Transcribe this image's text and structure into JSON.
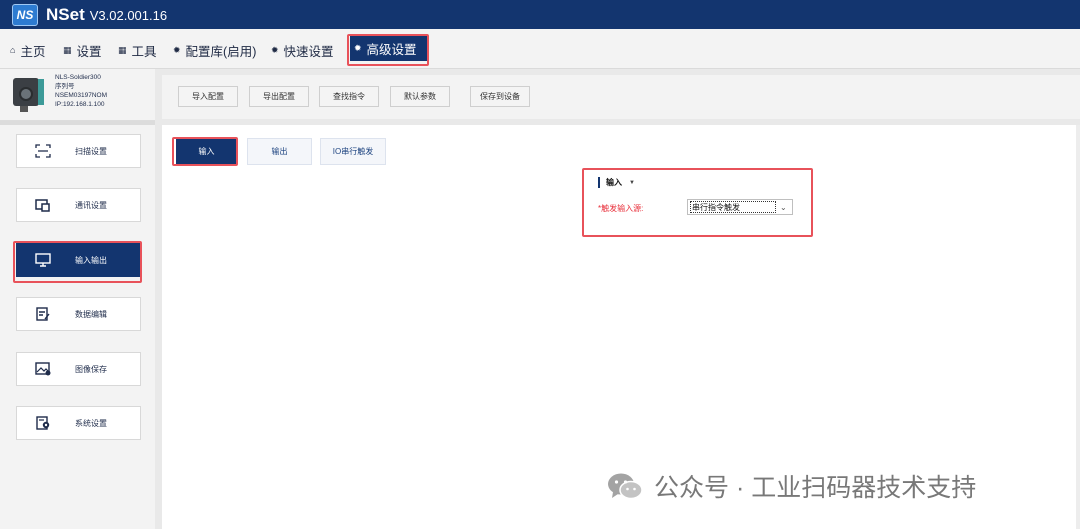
{
  "app": {
    "logo_text": "NS",
    "name": "NSet",
    "version": "V3.02.001.16",
    "accent": "#13356f",
    "highlight": "#e8525a"
  },
  "menu": {
    "home": "主页",
    "settings": "设置",
    "tools": "工具",
    "config_lib": "配置库(启用)",
    "quick_settings": "快速设置",
    "advanced_settings": "高级设置"
  },
  "device": {
    "model": "NLS-Soldier300",
    "serial_label": "序列号",
    "serial": "NSEM03197NOM",
    "ip": "IP:192.168.1.100"
  },
  "sidebar": {
    "items": [
      {
        "label": "扫描设置",
        "icon": "scan-icon"
      },
      {
        "label": "通讯设置",
        "icon": "communication-icon"
      },
      {
        "label": "输入输出",
        "icon": "monitor-icon"
      },
      {
        "label": "数据编辑",
        "icon": "edit-document-icon"
      },
      {
        "label": "图像保存",
        "icon": "image-save-icon"
      },
      {
        "label": "系统设置",
        "icon": "system-settings-icon"
      }
    ]
  },
  "toolbar": {
    "import_config": "导入配置",
    "export_config": "导出配置",
    "find_command": "查找指令",
    "default_params": "默认参数",
    "save_to_device": "保存到设备"
  },
  "tabs": {
    "input": "输入",
    "output": "输出",
    "io_serial": "IO串行触发"
  },
  "input_section": {
    "title": "输入",
    "trigger_source_label": "*触发输入源:",
    "trigger_source_value": "串行指令触发"
  },
  "watermark": {
    "text": "公众号 · 工业扫码器技术支持"
  }
}
